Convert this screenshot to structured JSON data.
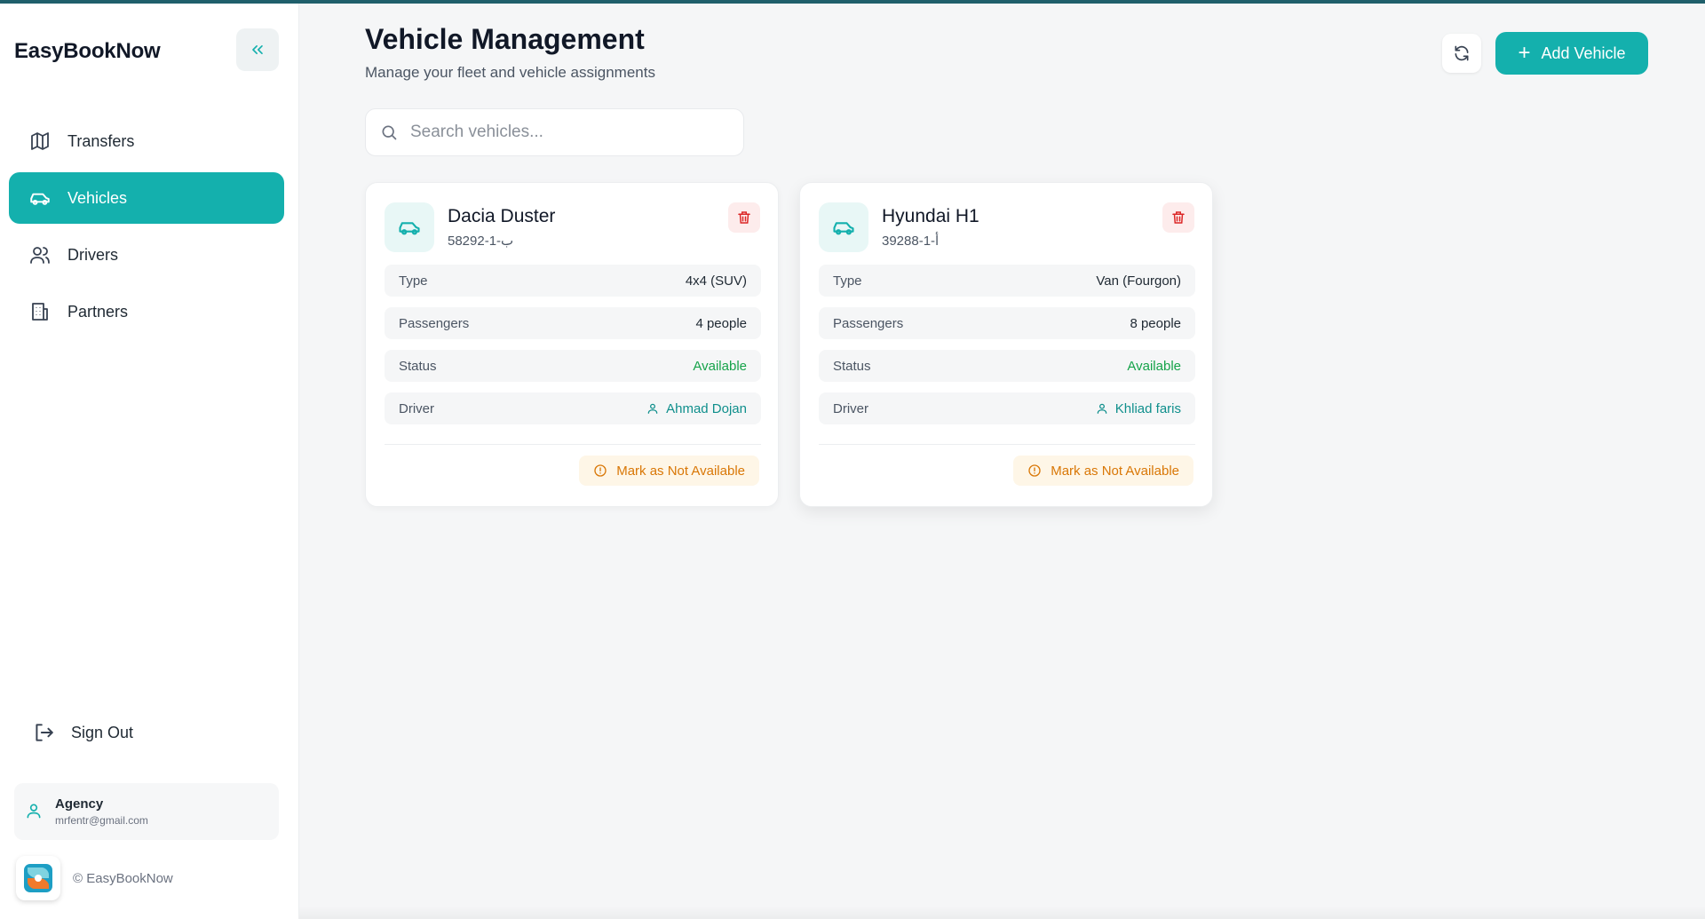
{
  "app": {
    "brand": "EasyBookNow",
    "copyright": "© EasyBookNow"
  },
  "colors": {
    "accent": "#14b0ad",
    "danger": "#dc2626",
    "warning": "#d97706",
    "success": "#16a34a"
  },
  "sidebar": {
    "items": [
      {
        "label": "Transfers",
        "icon": "map-icon",
        "active": false
      },
      {
        "label": "Vehicles",
        "icon": "car-icon",
        "active": true
      },
      {
        "label": "Drivers",
        "icon": "users-icon",
        "active": false
      },
      {
        "label": "Partners",
        "icon": "building-icon",
        "active": false
      }
    ],
    "sign_out": "Sign Out",
    "user": {
      "name": "Agency",
      "email": "mrfentr@gmail.com"
    }
  },
  "header": {
    "title": "Vehicle Management",
    "subtitle": "Manage your fleet and vehicle assignments",
    "add_label": "Add Vehicle"
  },
  "search": {
    "placeholder": "Search vehicles...",
    "value": ""
  },
  "vehicles": [
    {
      "name": "Dacia Duster",
      "plate": "58292-1-ب",
      "type_label": "Type",
      "type": "4x4 (SUV)",
      "passengers_label": "Passengers",
      "passengers": "4 people",
      "status_label": "Status",
      "status": "Available",
      "driver_label": "Driver",
      "driver": "Ahmad Dojan",
      "action": "Mark as Not Available"
    },
    {
      "name": "Hyundai H1",
      "plate": "39288-1-أ",
      "type_label": "Type",
      "type": "Van (Fourgon)",
      "passengers_label": "Passengers",
      "passengers": "8 people",
      "status_label": "Status",
      "status": "Available",
      "driver_label": "Driver",
      "driver": "Khliad faris",
      "action": "Mark as Not Available"
    }
  ]
}
